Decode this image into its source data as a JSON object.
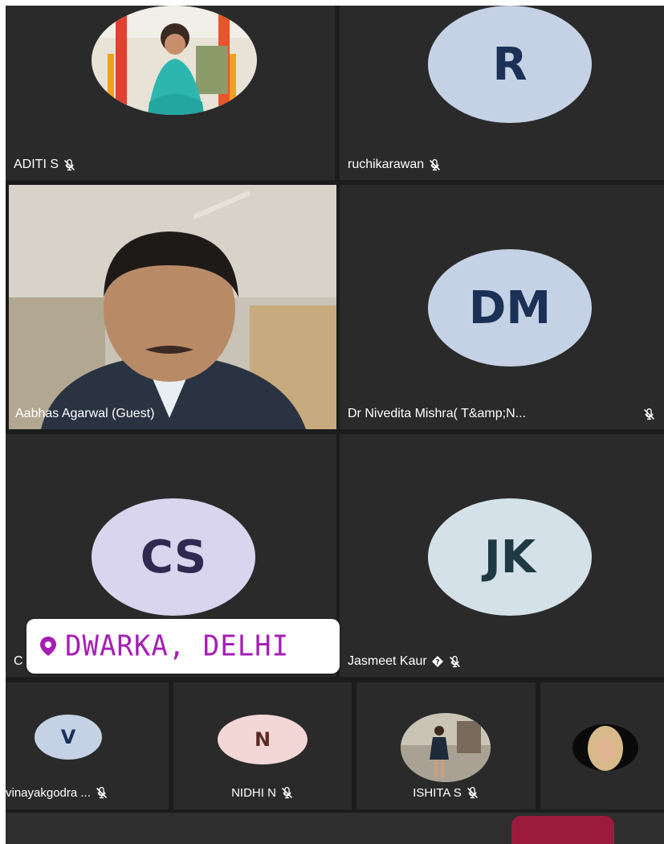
{
  "participants": [
    {
      "name": "ADITI S",
      "muted": true,
      "avatar_type": "photo"
    },
    {
      "name": "ruchikarawan",
      "muted": true,
      "avatar_type": "initials",
      "initials": "R",
      "avatar_color": "#c5d2e6",
      "text_color": "#1c3156"
    },
    {
      "name": "Aabhas Agarwal (Guest)",
      "muted": false,
      "avatar_type": "video"
    },
    {
      "name": "Dr Nivedita  Mishra( T&amp;N...",
      "muted": true,
      "avatar_type": "initials",
      "initials": "DM",
      "avatar_color": "#c5d2e6",
      "text_color": "#1c3156"
    },
    {
      "name": "C",
      "muted": false,
      "avatar_type": "initials",
      "initials": "CS",
      "avatar_color": "#d9d5ee",
      "text_color": "#2f2a4f"
    },
    {
      "name": "Jasmeet Kaur",
      "badge_icon": "diamond-question-icon",
      "muted": true,
      "avatar_type": "initials",
      "initials": "JK",
      "avatar_color": "#d4e1e8",
      "text_color": "#1f3a44"
    }
  ],
  "strip": [
    {
      "name": "vinayakgodra ...",
      "muted": true,
      "initials": "V",
      "avatar_color": "#c5d2e6",
      "text_color": "#1c3156"
    },
    {
      "name": "NIDHI N",
      "muted": true,
      "initials": "N",
      "avatar_color": "#f3d7d6",
      "text_color": "#5a2a26"
    },
    {
      "name": "ISHITA S",
      "muted": true,
      "avatar_type": "photo"
    },
    {
      "name": "",
      "avatar_type": "photo"
    }
  ],
  "location_sticker": {
    "text": "DWARKA, DELHI",
    "icon": "location-pin-icon",
    "color": "#a51fb5"
  },
  "controls": {
    "end_call_color": "#9c1b3c"
  }
}
